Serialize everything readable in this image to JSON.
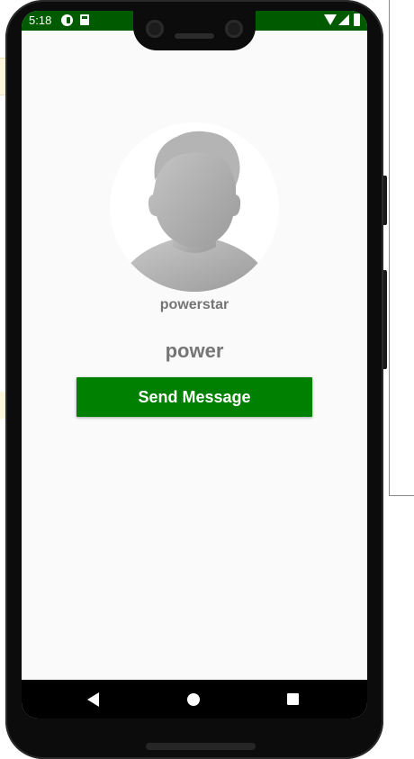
{
  "status_bar": {
    "time": "5:18",
    "color": "#005a00"
  },
  "icons": {
    "status_left": [
      "notification-icon",
      "sd-card-icon"
    ],
    "status_right": [
      "wifi-icon",
      "signal-icon",
      "battery-icon"
    ],
    "navigation": [
      "back-icon",
      "home-icon",
      "recents-icon"
    ],
    "avatar": "default-person-avatar-icon"
  },
  "profile": {
    "username": "powerstar",
    "display_name": "power"
  },
  "actions": {
    "send_message_label": "Send Message",
    "accent_color": "#008000"
  }
}
